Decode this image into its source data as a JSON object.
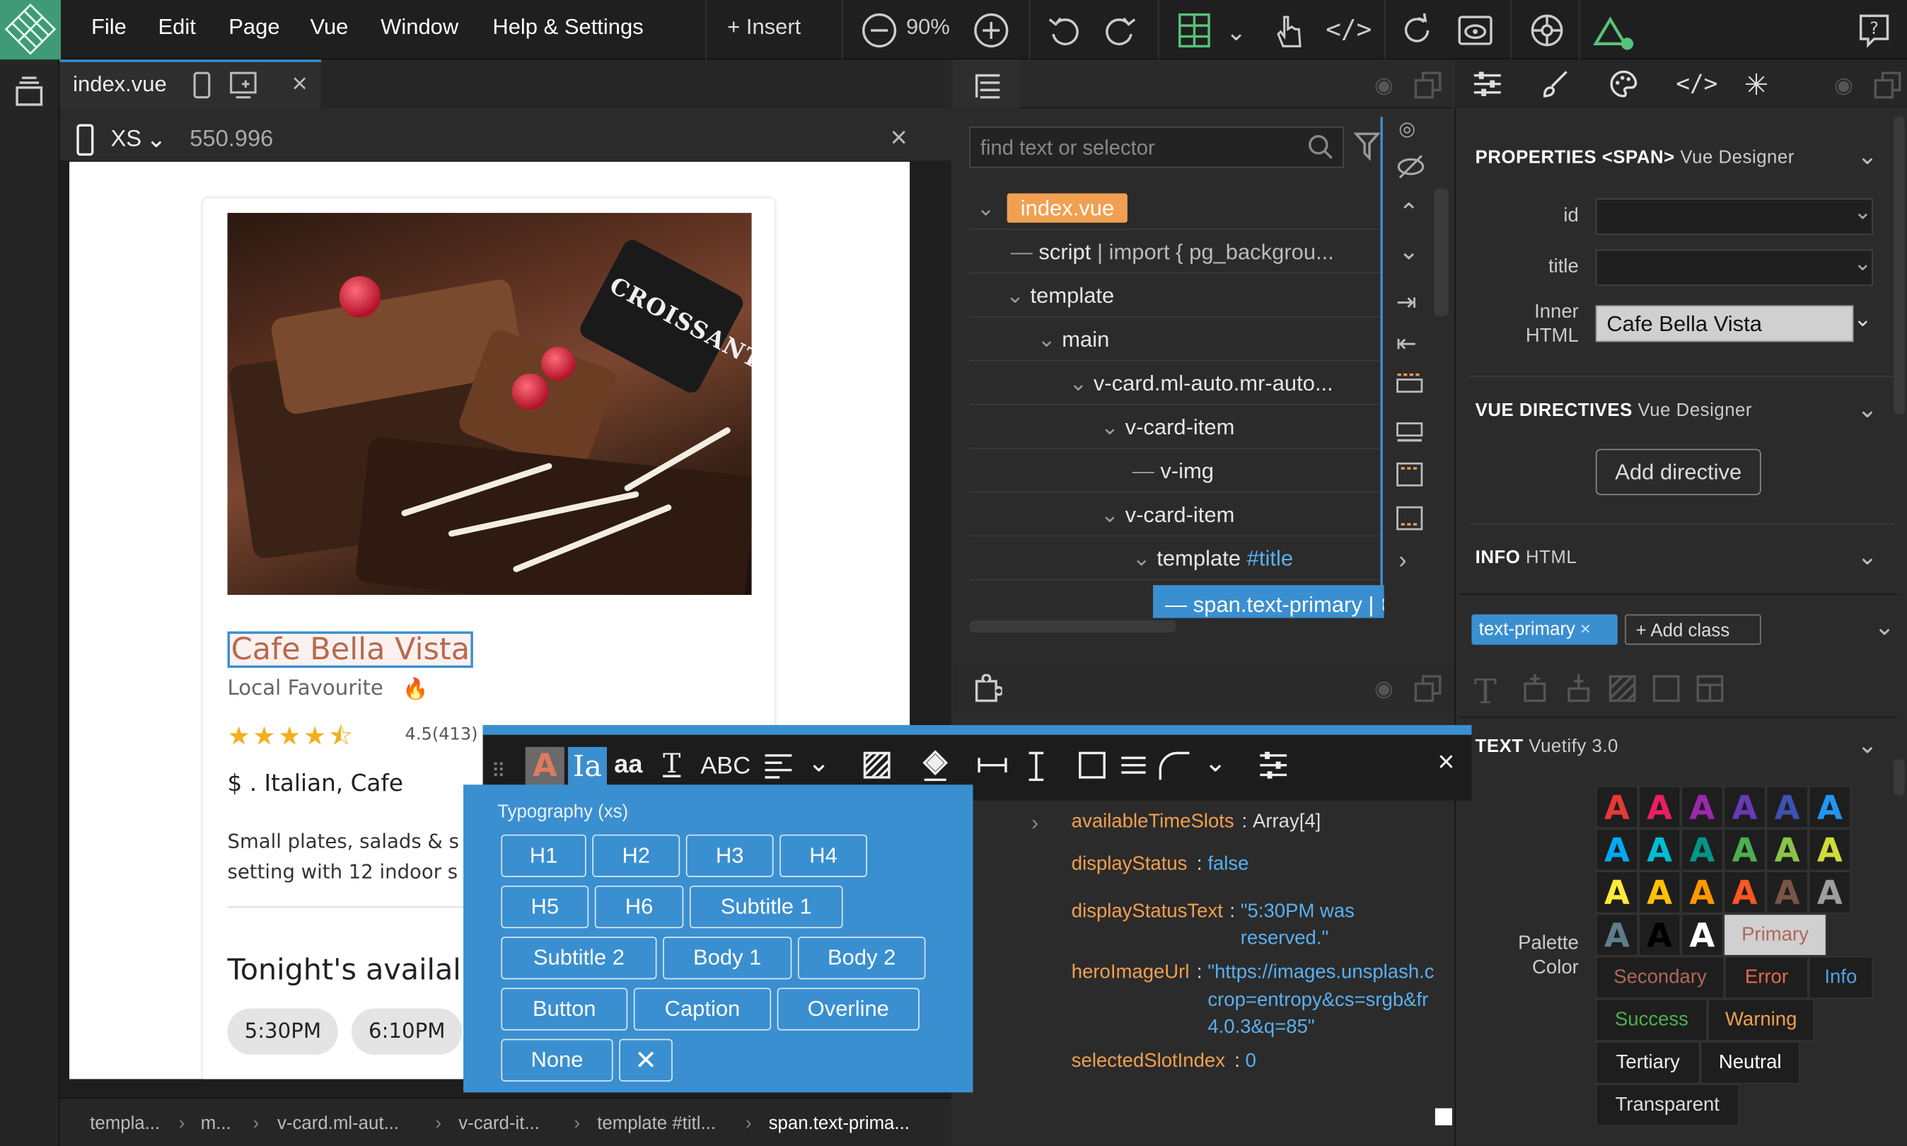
{
  "menu": {
    "file": "File",
    "edit": "Edit",
    "page": "Page",
    "vue": "Vue",
    "window": "Window",
    "help": "Help & Settings",
    "insert": "+ Insert",
    "zoom": "90%"
  },
  "tab": {
    "name": "index.vue"
  },
  "device": {
    "size": "XS",
    "width": "550.996"
  },
  "card": {
    "title": "Cafe Bella Vista",
    "subtitle": "Local Favourite",
    "stars": "★★★★⯪",
    "rating": "4.5(413)",
    "price": "$ . Italian, Cafe",
    "desc_line1": "Small plates, salads & s",
    "desc_line2": "setting with 12 indoor s",
    "heading": "Tonight's availal",
    "slots": [
      "5:30PM",
      "6:10PM"
    ],
    "photo_sign": "CROISSANT"
  },
  "breadcrumb": [
    "templa...",
    "m...",
    "v-card.ml-aut...",
    "v-card-it...",
    "template #titl...",
    "span.text-prima..."
  ],
  "tree": {
    "search_placeholder": "find text or selector",
    "rows": [
      {
        "label": "index.vue"
      },
      {
        "label": "script",
        "extra": " | import { pg_backgrou..."
      },
      {
        "label": "template"
      },
      {
        "label": "main"
      },
      {
        "label": "v-card.ml-auto.mr-auto..."
      },
      {
        "label": "v-card-item"
      },
      {
        "label": "v-img"
      },
      {
        "label": "v-card-item"
      },
      {
        "label": "template",
        "extra": "#title"
      },
      {
        "label": "span.text-primary",
        "extra": " | Cafe"
      }
    ]
  },
  "data_panel": [
    {
      "key": "availableTimeSlots",
      "value": "Array[4]"
    },
    {
      "key": "displayStatus",
      "value": "false"
    },
    {
      "key": "displayStatusText",
      "value": "\"5:30PM was",
      "value2": "reserved.\""
    },
    {
      "key": "heroImageUrl",
      "value": "\"https://images.unsplash.c",
      "value2": "crop=entropy&cs=srgb&fr",
      "value3": "4.0.3&q=85\""
    },
    {
      "key": "selectedSlotIndex",
      "value": "0"
    }
  ],
  "properties": {
    "header": "PROPERTIES <SPAN>",
    "header_sub": "Vue Designer",
    "id_label": "id",
    "title_label": "title",
    "inner_label": "Inner",
    "inner_label2": "HTML",
    "inner_value": "Cafe Bella Vista",
    "directives": "VUE DIRECTIVES",
    "directives_sub": "Vue Designer",
    "add_directive": "Add directive",
    "info": "INFO",
    "info_sub": "HTML",
    "class_chip": "text-primary",
    "add_class": "+ Add class",
    "text_header": "TEXT",
    "text_sub": "Vuetify 3.0",
    "palette_label": "Palette",
    "palette_label2": "Color"
  },
  "palette": {
    "row1": [
      "#e53935",
      "#e91e63",
      "#9c27b0",
      "#673ab7",
      "#3f51b5",
      "#2196f3"
    ],
    "row2": [
      "#03a9f4",
      "#00bcd4",
      "#009688",
      "#4caf50",
      "#8bc34a",
      "#cddc39"
    ],
    "row3": [
      "#ffeb3b",
      "#ffc107",
      "#ff9800",
      "#ff5722",
      "#795548",
      "#9e9e9e"
    ],
    "row4": [
      "#607d8b",
      "#000000",
      "#ffffff"
    ],
    "glyph": "A",
    "named": [
      "Primary",
      "Secondary",
      "Error",
      "Info",
      "Success",
      "Warning",
      "Tertiary",
      "Neutral",
      "Transparent"
    ],
    "named_colors": {
      "Primary": "#b0675a",
      "Secondary": "#b0675a",
      "Error": "#e56b4a",
      "Info": "#4fa3e6",
      "Success": "#4caf50",
      "Warning": "#f0a050",
      "Tertiary": "#eeeeee",
      "Neutral": "#ffffff",
      "Transparent": "#dddddd"
    }
  },
  "typography": {
    "title": "Typography (xs)",
    "buttons": [
      "H1",
      "H2",
      "H3",
      "H4",
      "H5",
      "H6",
      "Subtitle 1",
      "Subtitle 2",
      "Body 1",
      "Body 2",
      "Button",
      "Caption",
      "Overline",
      "None"
    ],
    "clear": "✕"
  },
  "toolbar": {
    "abc": "ABC",
    "aa": "aa"
  },
  "colors": {
    "accent": "#3a8fd0",
    "orange": "#f0a050",
    "title_text": "#b66a50"
  }
}
